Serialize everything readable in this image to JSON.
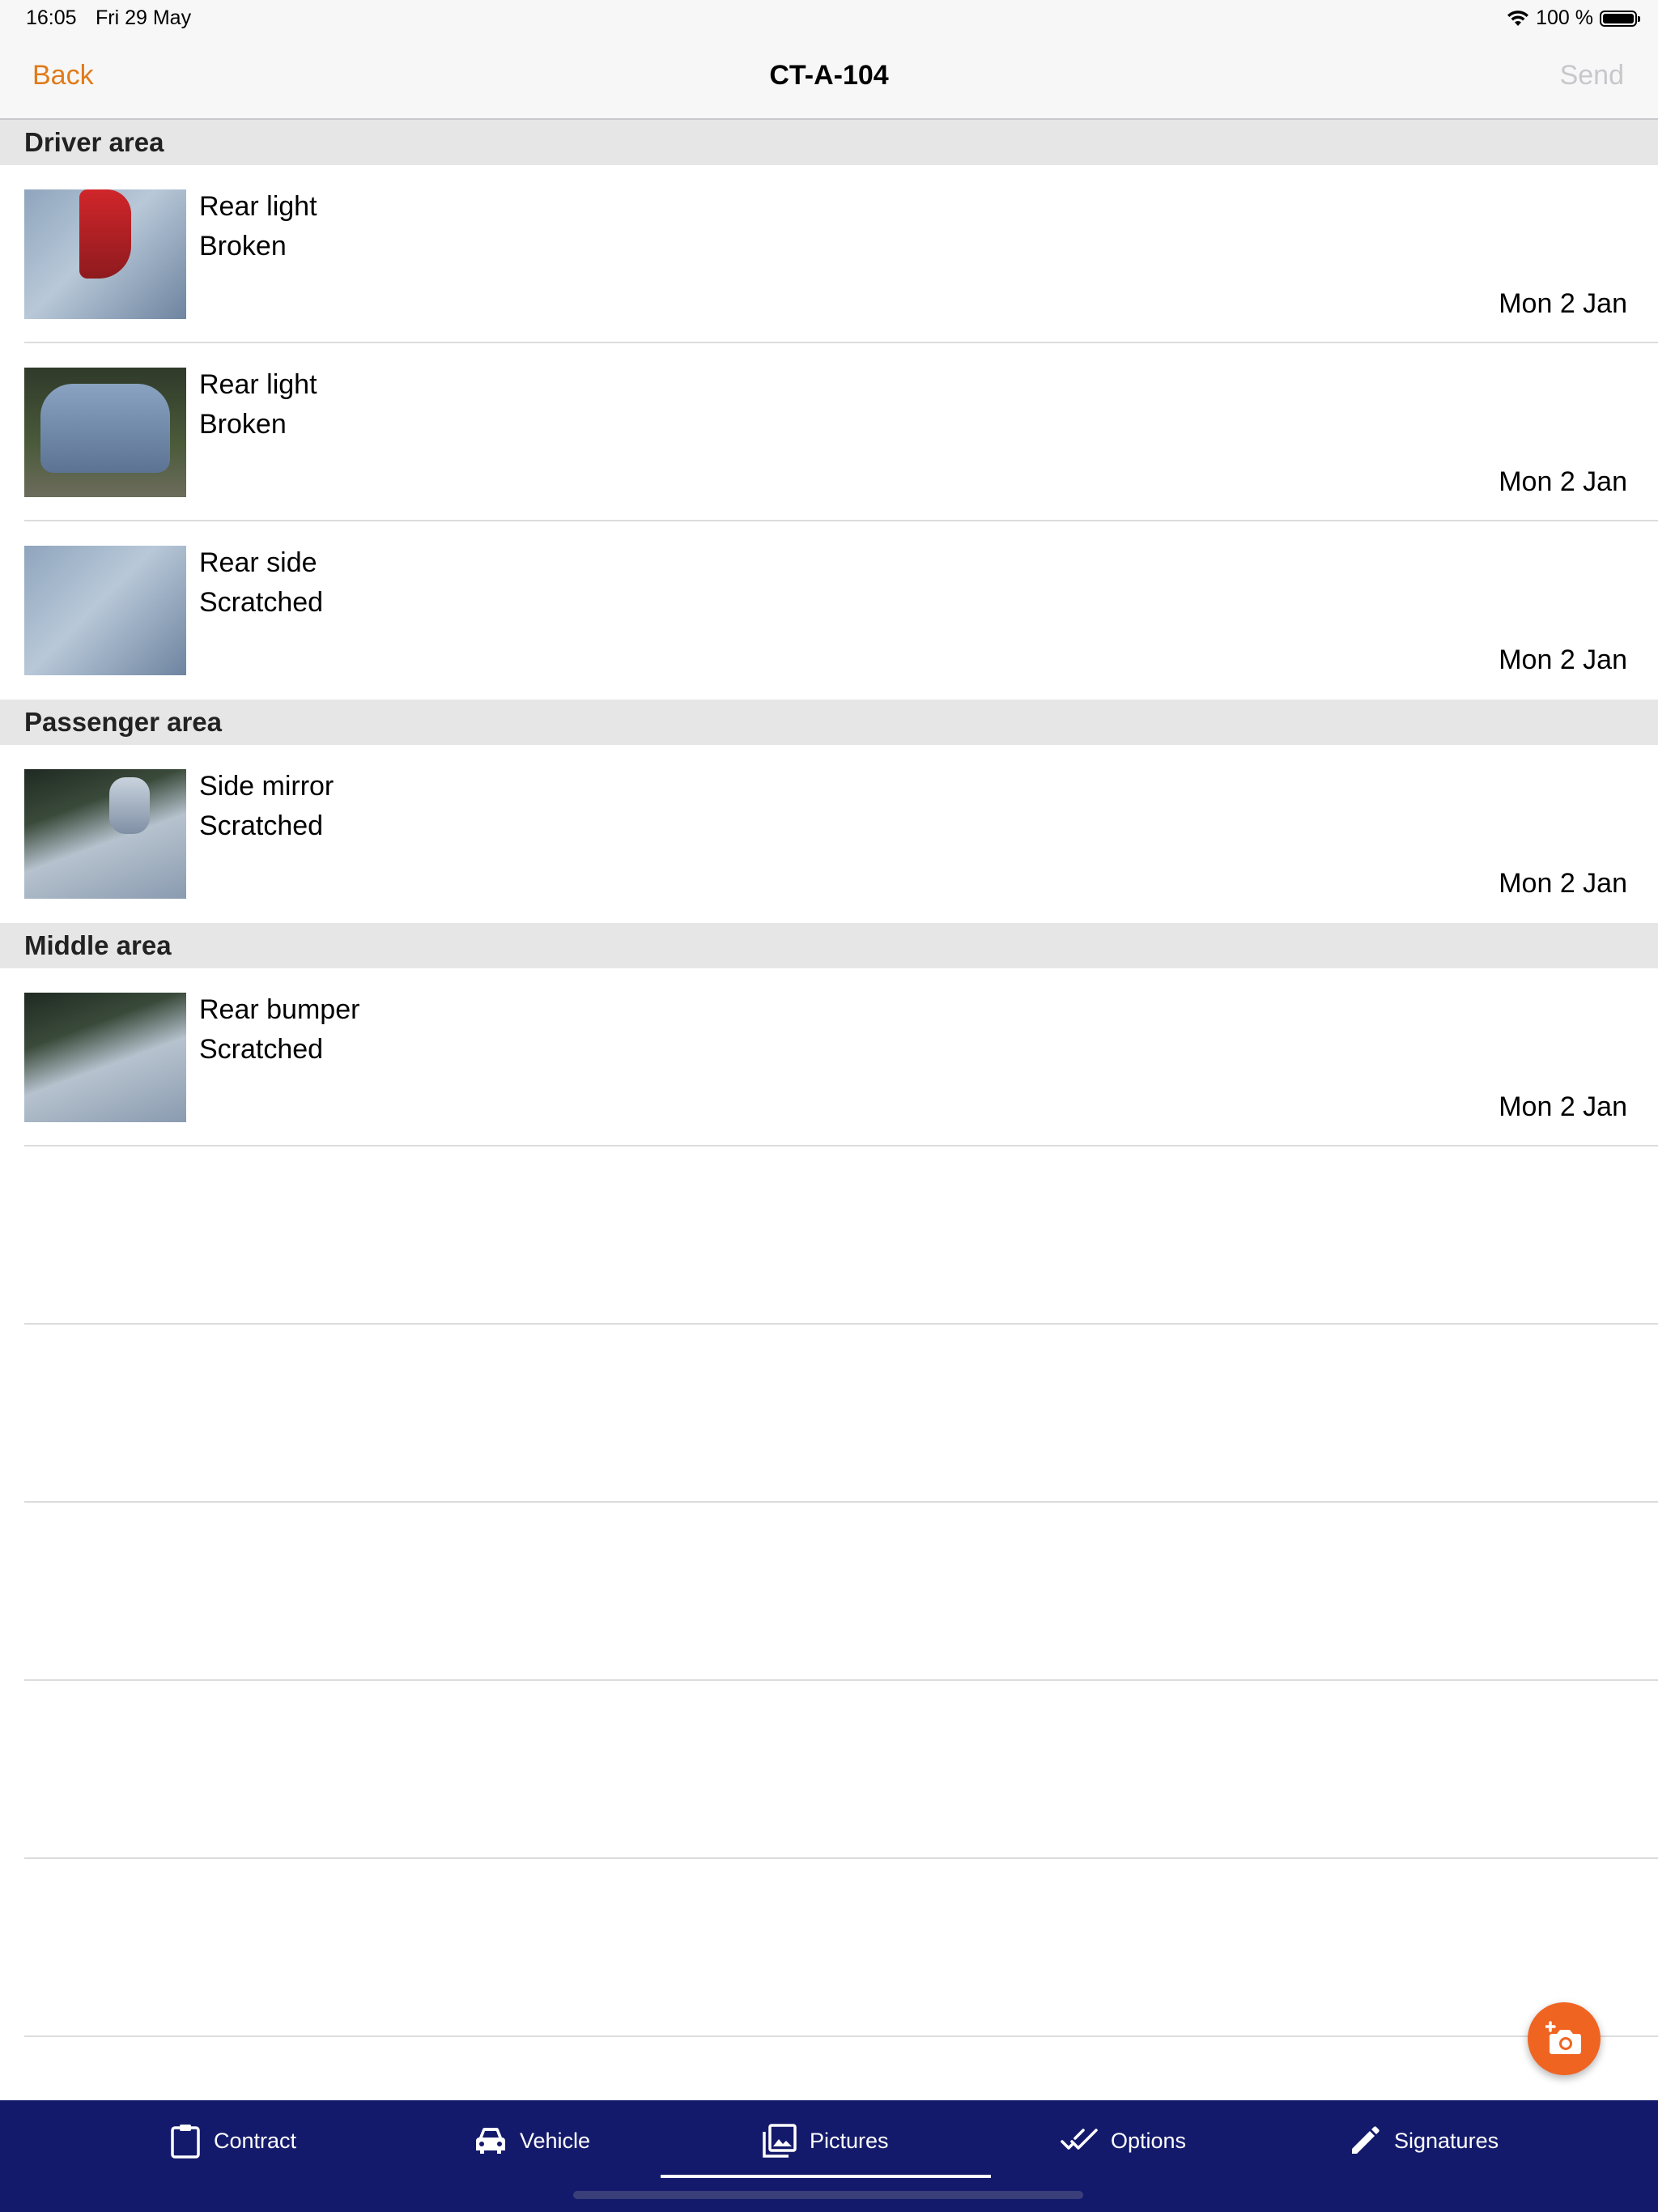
{
  "status_bar": {
    "time": "16:05",
    "date": "Fri 29 May",
    "battery": "100 %"
  },
  "nav": {
    "back": "Back",
    "title": "CT-A-104",
    "send": "Send"
  },
  "sections": [
    {
      "title": "Driver area",
      "items": [
        {
          "part": "Rear light",
          "damage": "Broken",
          "date": "Mon 2 Jan"
        },
        {
          "part": "Rear light",
          "damage": "Broken",
          "date": "Mon 2 Jan"
        },
        {
          "part": "Rear side",
          "damage": "Scratched",
          "date": "Mon 2 Jan"
        }
      ]
    },
    {
      "title": "Passenger area",
      "items": [
        {
          "part": "Side mirror",
          "damage": "Scratched",
          "date": "Mon 2 Jan"
        }
      ]
    },
    {
      "title": "Middle area",
      "items": [
        {
          "part": "Rear bumper",
          "damage": "Scratched",
          "date": "Mon 2 Jan"
        }
      ]
    }
  ],
  "tabs": [
    {
      "label": "Contract",
      "icon": "clipboard-icon"
    },
    {
      "label": "Vehicle",
      "icon": "car-icon"
    },
    {
      "label": "Pictures",
      "icon": "pictures-icon",
      "selected": true
    },
    {
      "label": "Options",
      "icon": "double-check-icon"
    },
    {
      "label": "Signatures",
      "icon": "pencil-icon"
    }
  ],
  "colors": {
    "accent": "#e07b1a",
    "fab": "#f06421",
    "tab_bar": "#141a6b",
    "section_header": "#e6e6e6"
  }
}
